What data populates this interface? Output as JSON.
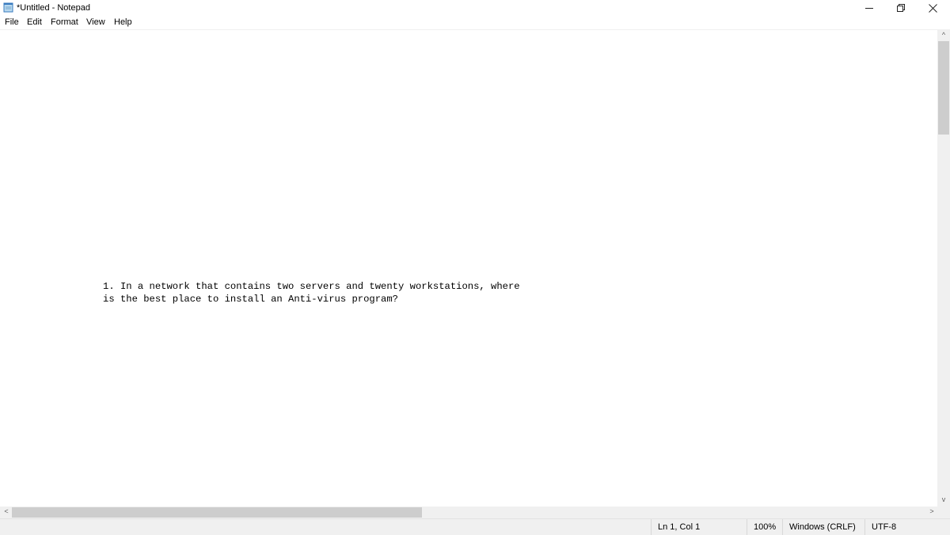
{
  "window": {
    "title": "*Untitled - Notepad",
    "icon": "notepad-icon",
    "controls": {
      "minimize_icon": "minimize-icon",
      "restore_icon": "restore-icon",
      "close_icon": "close-icon"
    }
  },
  "menu": {
    "items": [
      {
        "label": "File"
      },
      {
        "label": "Edit"
      },
      {
        "label": "Format"
      },
      {
        "label": "View"
      },
      {
        "label": "Help"
      }
    ]
  },
  "editor": {
    "lines": [
      "1. In a network that contains two servers and twenty workstations, where",
      "is the best place to install an Anti-virus program?"
    ]
  },
  "scrollbars": {
    "up_arrow": "^",
    "down_arrow": "v",
    "left_arrow": "<",
    "right_arrow": ">"
  },
  "status": {
    "position": "Ln 1, Col 1",
    "zoom": "100%",
    "line_ending": "Windows (CRLF)",
    "encoding": "UTF-8"
  }
}
